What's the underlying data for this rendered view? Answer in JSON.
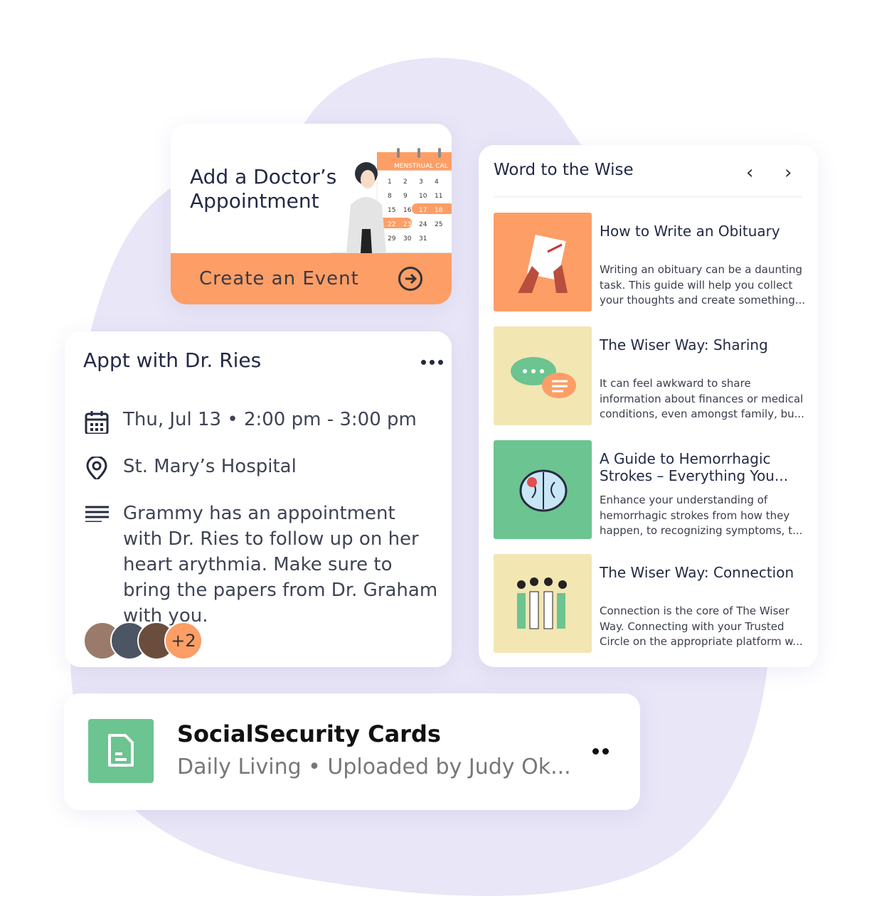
{
  "colors": {
    "accent": "#fc9e66",
    "green": "#6cc490",
    "cream": "#f2e6b3",
    "blob": "#e8e6f7"
  },
  "doctor_card": {
    "title_line1": "Add a Doctor’s",
    "title_line2": "Appointment",
    "calendar_header": "MENSTRUAL CAL",
    "calendar_days": [
      "1",
      "2",
      "3",
      "4",
      "8",
      "9",
      "10",
      "11",
      "15",
      "16",
      "17",
      "18",
      "22",
      "23",
      "24",
      "25",
      "29",
      "30",
      "31"
    ],
    "action_label": "Create an Event",
    "action_icon": "arrow-right-circle-icon"
  },
  "appointment": {
    "title": "Appt with Dr. Ries",
    "datetime": "Thu, Jul 13 • 2:00 pm - 3:00 pm",
    "location": "St. Mary’s Hospital",
    "notes": "Grammy has an appointment with Dr. Ries to follow up on her heart arythmia. Make sure to bring the papers from Dr. Graham with you.",
    "extra_attendees": "+2"
  },
  "wise": {
    "title": "Word to the Wise",
    "articles": [
      {
        "title": "How to Write an Obituary",
        "desc": "Writing an obituary can be a daunting task. This guide will help you collect your thoughts and create something...",
        "thumb": "writing-hands"
      },
      {
        "title": "The Wiser Way: Sharing",
        "desc": "It can feel awkward to share information about finances or medical conditions, even amongst family, bu...",
        "thumb": "chat-bubbles"
      },
      {
        "title": "A Guide to Hemorrhagic Strokes – Everything You...",
        "desc": "Enhance your understanding of hemorrhagic strokes from how they happen, to recognizing symptoms, t...",
        "thumb": "brain"
      },
      {
        "title": "The Wiser Way: Connection",
        "desc": "Connection is the core of The Wiser Way. Connecting with your Trusted Circle on the appropriate platform w...",
        "thumb": "group-of-people"
      }
    ]
  },
  "file": {
    "title": "SocialSecurity Cards",
    "subtitle": "Daily Living • Uploaded by Judy Ok..."
  }
}
